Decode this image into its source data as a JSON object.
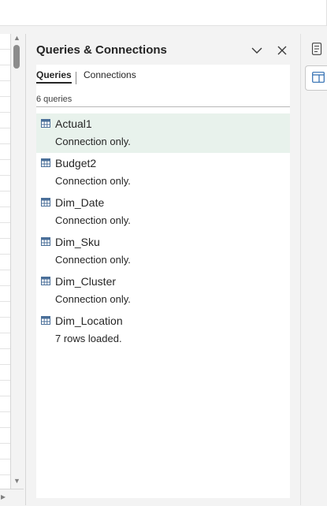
{
  "pane": {
    "title": "Queries & Connections",
    "tabs": [
      {
        "label": "Queries",
        "active": true
      },
      {
        "label": "Connections",
        "active": false
      }
    ],
    "count_label": "6 queries",
    "queries": [
      {
        "name": "Actual1",
        "status": "Connection only.",
        "selected": true
      },
      {
        "name": "Budget2",
        "status": "Connection only.",
        "selected": false
      },
      {
        "name": "Dim_Date",
        "status": "Connection only.",
        "selected": false
      },
      {
        "name": "Dim_Sku",
        "status": "Connection only.",
        "selected": false
      },
      {
        "name": "Dim_Cluster",
        "status": "Connection only.",
        "selected": false
      },
      {
        "name": "Dim_Location",
        "status": "7 rows loaded.",
        "selected": false
      }
    ]
  },
  "icons": {
    "pane_menu": "chevron-down-icon",
    "pane_close": "close-icon",
    "query": "table-icon",
    "rail_top": "document-icon",
    "rail_active": "panel-icon"
  },
  "colors": {
    "selected_row": "#e8f2ec",
    "icon_blue": "#4a6f99"
  }
}
